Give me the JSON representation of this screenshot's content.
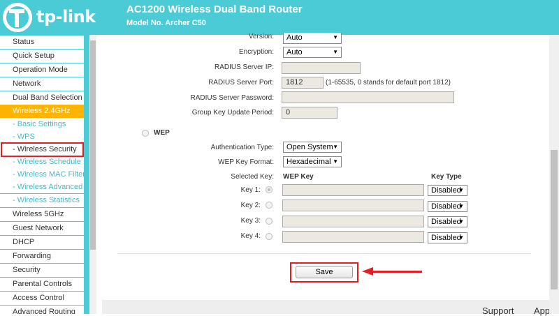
{
  "header": {
    "logo_text": "tp-link",
    "title": "AC1200 Wireless Dual Band Router",
    "model": "Model No. Archer C50"
  },
  "sidebar": {
    "items": [
      {
        "label": "Status"
      },
      {
        "label": "Quick Setup"
      },
      {
        "label": "Operation Mode"
      },
      {
        "label": "Network"
      },
      {
        "label": "Dual Band Selection"
      },
      {
        "label": "Wireless 2.4GHz"
      },
      {
        "label": "- Basic Settings"
      },
      {
        "label": "- WPS"
      },
      {
        "label": "- Wireless Security"
      },
      {
        "label": "- Wireless Schedule"
      },
      {
        "label": "- Wireless MAC Filtering"
      },
      {
        "label": "- Wireless Advanced"
      },
      {
        "label": "- Wireless Statistics"
      },
      {
        "label": "Wireless 5GHz"
      },
      {
        "label": "Guest Network"
      },
      {
        "label": "DHCP"
      },
      {
        "label": "Forwarding"
      },
      {
        "label": "Security"
      },
      {
        "label": "Parental Controls"
      },
      {
        "label": "Access Control"
      },
      {
        "label": "Advanced Routing"
      }
    ]
  },
  "form": {
    "version_label": "Version:",
    "version_value": "Auto",
    "encryption_label": "Encryption:",
    "encryption_value": "Auto",
    "radius_ip_label": "RADIUS Server IP:",
    "radius_ip_value": "",
    "radius_port_label": "RADIUS Server Port:",
    "radius_port_value": "1812",
    "radius_port_note": "(1-65535, 0 stands for default port 1812)",
    "radius_password_label": "RADIUS Server Password:",
    "radius_password_value": "",
    "group_key_label": "Group Key Update Period:",
    "group_key_value": "0",
    "wep_label": "WEP",
    "auth_type_label": "Authentication Type:",
    "auth_type_value": "Open System",
    "wep_key_format_label": "WEP Key Format:",
    "wep_key_format_value": "Hexadecimal",
    "selected_key_label": "Selected Key:",
    "wep_key_header": "WEP Key",
    "key_type_header": "Key Type",
    "keys": [
      {
        "label": "Key 1:",
        "value": "",
        "type": "Disabled"
      },
      {
        "label": "Key 2:",
        "value": "",
        "type": "Disabled"
      },
      {
        "label": "Key 3:",
        "value": "",
        "type": "Disabled"
      },
      {
        "label": "Key 4:",
        "value": "",
        "type": "Disabled"
      }
    ],
    "save_label": "Save"
  },
  "footer": {
    "support_label": "Support",
    "app_label": "App"
  },
  "colors": {
    "brand": "#4acbd6",
    "active_nav": "#ffb400",
    "annotation_red": "#e31e24",
    "sub_nav_text": "#4bb8c8"
  }
}
